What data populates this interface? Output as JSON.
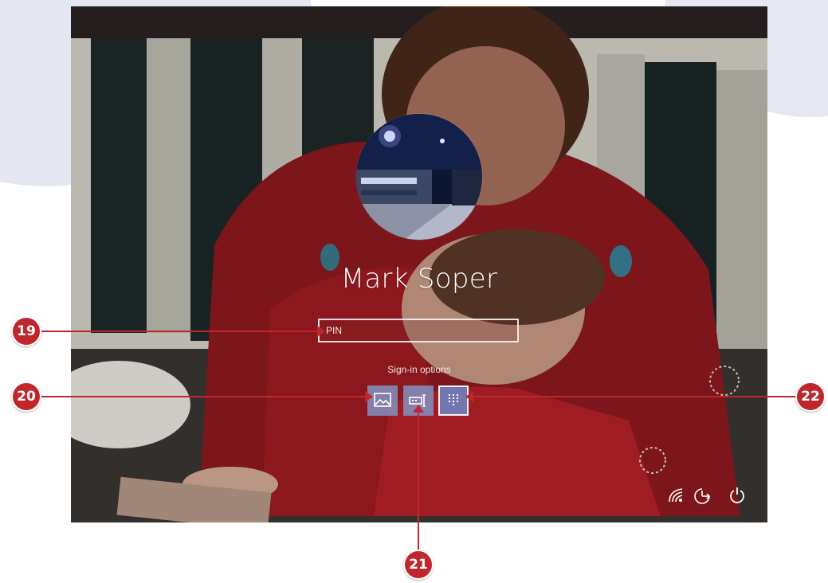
{
  "login": {
    "user_name": "Mark Soper",
    "pin_placeholder": "PIN",
    "signin_options_label": "Sign-in options",
    "signin_options": [
      {
        "icon": "picture-password-icon"
      },
      {
        "icon": "password-key-icon"
      },
      {
        "icon": "pin-keypad-icon",
        "selected": true
      }
    ],
    "tray_icons": [
      "network-icon",
      "ease-of-access-icon",
      "power-icon"
    ]
  },
  "callouts": {
    "c19": "19",
    "c20": "20",
    "c21": "21",
    "c22": "22"
  },
  "colors": {
    "callout_red": "#c0272d",
    "signin_button": "#8296c8"
  }
}
